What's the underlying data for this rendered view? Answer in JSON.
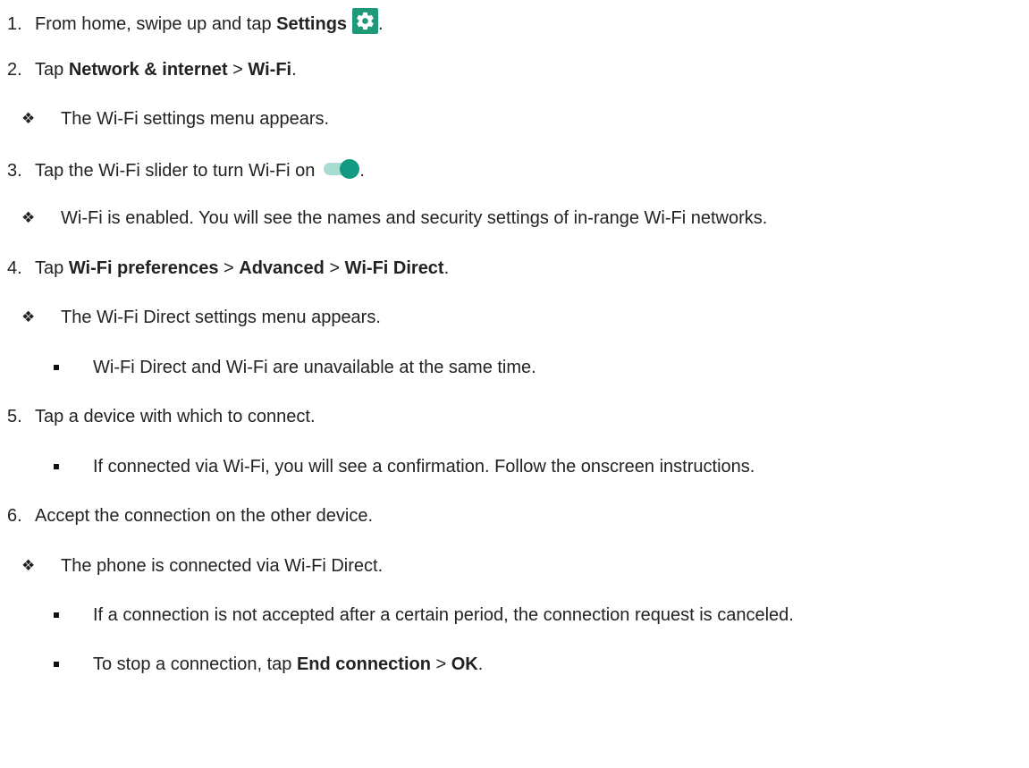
{
  "steps": {
    "s1": {
      "num": "1.",
      "pre": "From home, swipe up and tap ",
      "b1": "Settings",
      "post": "."
    },
    "s2": {
      "num": "2.",
      "pre": "Tap ",
      "b1": "Network & internet",
      "sep": " > ",
      "b2": "Wi-Fi",
      "post": "."
    },
    "n2a": {
      "text": "The Wi-Fi settings menu appears."
    },
    "s3": {
      "num": "3.",
      "pre": "Tap the Wi-Fi slider to turn Wi-Fi on",
      "post": "."
    },
    "n3a": {
      "text": "Wi-Fi is enabled. You will see the names and security settings of in-range Wi-Fi networks."
    },
    "s4": {
      "num": "4.",
      "pre": "Tap ",
      "b1": "Wi-Fi preferences",
      "sep1": " > ",
      "b2": "Advanced",
      "sep2": " > ",
      "b3": "Wi-Fi Direct",
      "post": "."
    },
    "n4a": {
      "text": "The Wi-Fi Direct settings menu appears."
    },
    "b4a": {
      "text": "Wi-Fi Direct and Wi-Fi are unavailable at the same time."
    },
    "s5": {
      "num": "5.",
      "text": "Tap a device with which to connect."
    },
    "b5a": {
      "text": "If connected via Wi-Fi, you will see a confirmation. Follow the onscreen instructions."
    },
    "s6": {
      "num": "6.",
      "text": "Accept the connection on the other device."
    },
    "n6a": {
      "text": "The phone is connected via Wi-Fi Direct."
    },
    "b6a": {
      "text": "If a connection is not accepted after a certain period, the connection request is canceled."
    },
    "b6b": {
      "pre": "To stop a connection, tap ",
      "b1": "End connection",
      "sep": " > ",
      "b2": "OK",
      "post": "."
    }
  },
  "symbols": {
    "diamond": "❖"
  },
  "icons": {
    "settings": "gear-icon",
    "toggle": "toggle-on-icon"
  },
  "colors": {
    "settings_icon_bg": "#1f9a78",
    "toggle_knob": "#129a83",
    "toggle_track": "#a8dcd0"
  }
}
